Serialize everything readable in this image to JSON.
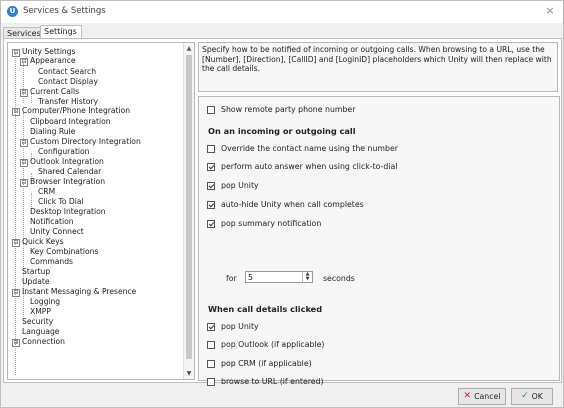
{
  "window": {
    "title": "Services & Settings",
    "close_glyph": "×"
  },
  "tabs": [
    {
      "label": "Services"
    },
    {
      "label": "Settings"
    }
  ],
  "tree": {
    "items": [
      {
        "label": "Unity Settings",
        "exp": "⊟"
      },
      {
        "label": "Appearance",
        "exp": "⊟"
      },
      {
        "label": "Contact Search"
      },
      {
        "label": "Contact Display"
      },
      {
        "label": "Current Calls",
        "exp": "⊟"
      },
      {
        "label": "Transfer History"
      },
      {
        "label": "Computer/Phone Integration",
        "exp": "⊟"
      },
      {
        "label": "Clipboard Integration"
      },
      {
        "label": "Dialing Rule"
      },
      {
        "label": "Custom Directory Integration",
        "exp": "⊟"
      },
      {
        "label": "Configuration"
      },
      {
        "label": "Outlook Integration",
        "exp": "⊟"
      },
      {
        "label": "Shared Calendar"
      },
      {
        "label": "Browser Integration",
        "exp": "⊟"
      },
      {
        "label": "CRM"
      },
      {
        "label": "Click To Dial"
      },
      {
        "label": "Desktop Integration"
      },
      {
        "label": "Notification"
      },
      {
        "label": "Unity Connect"
      },
      {
        "label": "Quick Keys",
        "exp": "⊟"
      },
      {
        "label": "Key Combinations"
      },
      {
        "label": "Commands"
      },
      {
        "label": "Startup"
      },
      {
        "label": "Update"
      },
      {
        "label": "Instant Messaging & Presence",
        "exp": "⊟"
      },
      {
        "label": "Logging"
      },
      {
        "label": "XMPP"
      },
      {
        "label": "Security"
      },
      {
        "label": "Language"
      },
      {
        "label": "Connection",
        "exp": "⊞"
      }
    ],
    "scroll_up": "▲",
    "scroll_down": "▼"
  },
  "description": "Specify how to be notified of incoming or outgoing calls.  When browsing to a URL, use the [Number], [Direction], [CallID] and [LoginID] placeholders which Unity will then replace with the call details.",
  "options": {
    "show_remote_party": {
      "label": "Show remote party phone number",
      "checked": false
    },
    "section_incoming": "On an incoming or outgoing call",
    "override_contact": {
      "label": "Override the contact name using the number",
      "checked": false
    },
    "auto_answer": {
      "label": "perform auto answer when using click-to-dial",
      "checked": true
    },
    "pop_unity": {
      "label": "pop Unity",
      "checked": true
    },
    "auto_hide": {
      "label": "auto-hide Unity when call completes",
      "checked": true
    },
    "pop_summary": {
      "label": "pop summary notification",
      "checked": true
    },
    "for_label": "for",
    "for_value": "5",
    "seconds_label": "seconds",
    "section_details": "When call details clicked",
    "pop_unity_details": {
      "label": "pop Unity",
      "checked": true
    },
    "pop_outlook": {
      "label": "pop Outlook (if applicable)",
      "checked": false
    },
    "pop_crm": {
      "label": "pop CRM (if applicable)",
      "checked": false
    },
    "browse_url": {
      "label": "browse to URL (if entered)",
      "checked": false
    }
  },
  "buttons": {
    "cancel": {
      "label": "Cancel",
      "icon": "x-icon"
    },
    "ok": {
      "label": "OK",
      "icon": "check-icon"
    }
  }
}
